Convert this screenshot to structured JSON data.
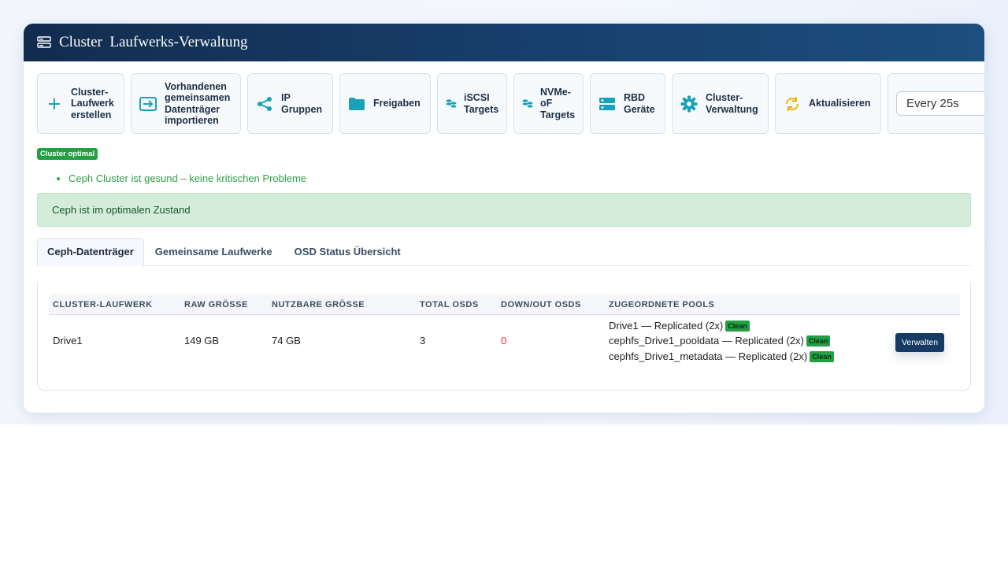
{
  "header": {
    "app_name": "Cluster",
    "section": "Laufwerks-Verwaltung",
    "icon": "server-icon"
  },
  "toolbar": {
    "buttons": [
      {
        "label": "Cluster-Laufwerk erstellen",
        "icon": "plus-icon"
      },
      {
        "label": "Vorhandenen gemeinsamen Datenträger importieren",
        "icon": "import-icon"
      },
      {
        "label": "IP Gruppen",
        "icon": "share-icon"
      },
      {
        "label": "Freigaben",
        "icon": "folder-icon"
      },
      {
        "label": "iSCSI Targets",
        "icon": "database-icon"
      },
      {
        "label": "NVMe-oF Targets",
        "icon": "database-icon"
      },
      {
        "label": "RBD Geräte",
        "icon": "server-icon"
      },
      {
        "label": "Cluster-Verwaltung",
        "icon": "gear-icon"
      },
      {
        "label": "Aktualisieren",
        "icon": "refresh-icon"
      }
    ],
    "refresh_interval": "Every 25s"
  },
  "status": {
    "badge": "Cluster optimal",
    "messages": [
      "Ceph Cluster ist gesund – keine kritischen Probleme"
    ],
    "alert": "Ceph ist im optimalen Zustand"
  },
  "tabs": [
    {
      "label": "Ceph-Datenträger",
      "active": true
    },
    {
      "label": "Gemeinsame Laufwerke",
      "active": false
    },
    {
      "label": "OSD Status Übersicht",
      "active": false
    }
  ],
  "table": {
    "columns": [
      "CLUSTER-LAUFWERK",
      "RAW GRÖSSE",
      "NUTZBARE GRÖSSE",
      "TOTAL OSDS",
      "DOWN/OUT OSDS",
      "ZUGEORDNETE POOLS"
    ],
    "rows": [
      {
        "name": "Drive1",
        "raw": "149 GB",
        "usable": "74 GB",
        "total_osds": "3",
        "down_out": "0",
        "pools": [
          {
            "text": "Drive1 — Replicated (2x)",
            "state": "Clean"
          },
          {
            "text": "cephfs_Drive1_pooldata — Replicated (2x)",
            "state": "Clean"
          },
          {
            "text": "cephfs_Drive1_metadata — Replicated (2x)",
            "state": "Clean"
          }
        ],
        "action": "Verwalten"
      }
    ]
  },
  "colors": {
    "accent": "#17a2b8",
    "header": "#173e6a",
    "success": "#23a044",
    "refresh": "#f0b400"
  }
}
